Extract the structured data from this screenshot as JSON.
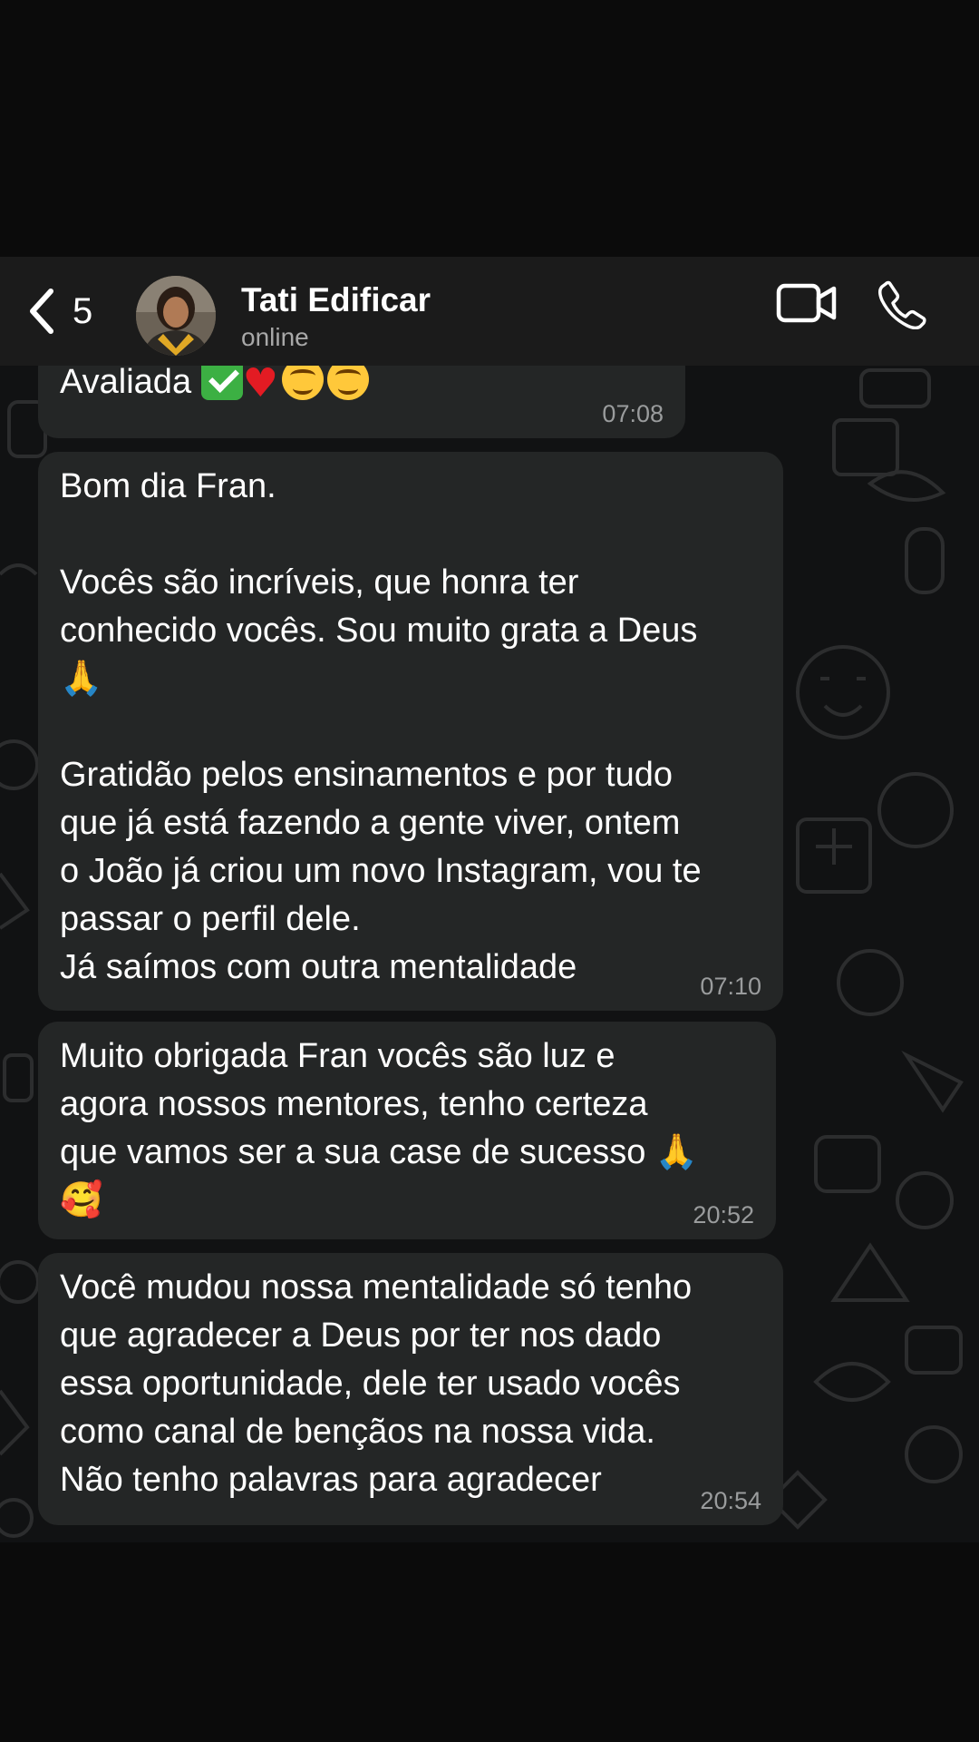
{
  "header": {
    "back_count": "5",
    "contact_name": "Tati Edificar",
    "status": "online",
    "icons": [
      "chevron-left-icon",
      "video-call-icon",
      "phone-call-icon"
    ]
  },
  "messages": [
    {
      "text": "Avaliada",
      "emojis": [
        "white-check-mark",
        "red-heart",
        "savoring-face",
        "savoring-face"
      ],
      "time": "07:08"
    },
    {
      "text": "Bom dia Fran.\n\nVocês são incríveis, que honra ter\nconhecido vocês. Sou muito grata a Deus\n🙏\n\nGratidão pelos ensinamentos e por tudo\nque já está fazendo a gente viver, ontem\no João já criou um novo Instagram, vou te\npassar o perfil dele.\nJá saímos com outra mentalidade",
      "time": "07:10"
    },
    {
      "text": "Muito obrigada Fran vocês são luz e\nagora nossos mentores, tenho certeza\nque vamos ser a sua case de sucesso 🙏\n🥰",
      "time": "20:52"
    },
    {
      "text": "Você mudou nossa mentalidade só tenho\nque agradecer a Deus por ter nos dado\nessa oportunidade, dele ter usado vocês\ncomo canal de bençãos na nossa vida.\nNão tenho palavras para agradecer",
      "time": "20:54"
    }
  ],
  "colors": {
    "header_bg": "#1b1b1b",
    "chat_bg": "#111213",
    "bubble_bg": "#242626",
    "time_text": "#9a9c9d",
    "status_text": "#a8a8a8"
  }
}
